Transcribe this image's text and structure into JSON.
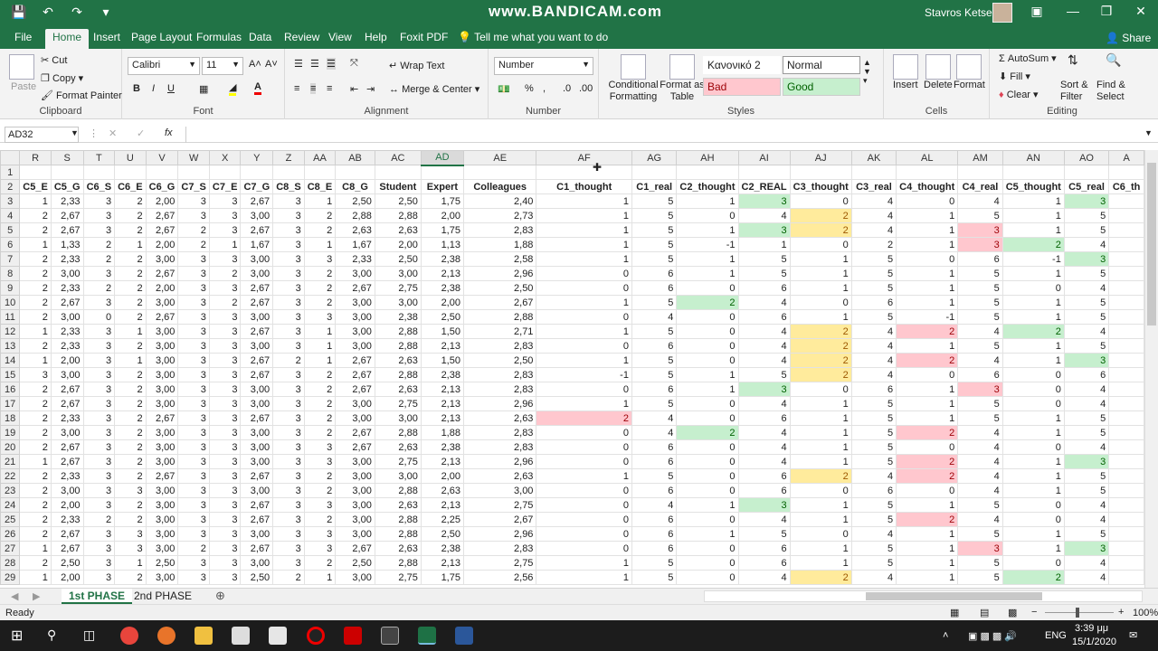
{
  "window": {
    "watermark": "www.BANDICAM.com",
    "user": "Stavros Ketseas"
  },
  "tabs": [
    "File",
    "Home",
    "Insert",
    "Page Layout",
    "Formulas",
    "Data",
    "Review",
    "View",
    "Help",
    "Foxit PDF"
  ],
  "tell_me": "Tell me what you want to do",
  "share": "Share",
  "clipboard": {
    "cut": "Cut",
    "copy": "Copy",
    "paste": "Paste",
    "format_painter": "Format Painter",
    "label": "Clipboard"
  },
  "font": {
    "name": "Calibri",
    "size": "11",
    "label": "Font"
  },
  "alignment": {
    "wrap": "Wrap Text",
    "merge": "Merge & Center",
    "label": "Alignment"
  },
  "number": {
    "format": "Number",
    "label": "Number"
  },
  "styles": {
    "cond": "Conditional Formatting",
    "table": "Format as Table",
    "normal_gr": "Κανονικό 2",
    "normal": "Normal",
    "bad": "Bad",
    "good": "Good",
    "label": "Styles"
  },
  "cells": {
    "insert": "Insert",
    "delete": "Delete",
    "format": "Format",
    "label": "Cells"
  },
  "editing": {
    "autosum": "AutoSum",
    "fill": "Fill",
    "clear": "Clear",
    "sort": "Sort & Filter",
    "find": "Find & Select",
    "label": "Editing"
  },
  "namebox": "AD32",
  "columns": [
    "R",
    "S",
    "T",
    "U",
    "V",
    "W",
    "X",
    "Y",
    "Z",
    "AA",
    "AB",
    "AC",
    "AD",
    "AE",
    "AF",
    "AG",
    "AH",
    "AI",
    "AJ",
    "AK",
    "AL",
    "AM",
    "AN",
    "AO",
    "A"
  ],
  "headers": [
    "C5_E",
    "C5_G",
    "C6_S",
    "C6_E",
    "C6_G",
    "C7_S",
    "C7_E",
    "C7_G",
    "C8_S",
    "C8_E",
    "C8_G",
    "Student",
    "Expert",
    "Colleagues",
    "C1_thought",
    "C1_real",
    "C2_thought",
    "C2_REAL",
    "C3_thought",
    "C3_real",
    "C4_thought",
    "C4_real",
    "C5_thought",
    "C5_real",
    "C6_th"
  ],
  "rows": [
    [
      "1",
      "2,33",
      "3",
      "2",
      "2,00",
      "3",
      "3",
      "2,67",
      "3",
      "1",
      "2,50",
      "2,50",
      "1,75",
      "2,40",
      "1",
      "5",
      "1",
      "3",
      "0",
      "4",
      "0",
      "4",
      "1",
      "3"
    ],
    [
      "2",
      "2,67",
      "3",
      "2",
      "2,67",
      "3",
      "3",
      "3,00",
      "3",
      "2",
      "2,88",
      "2,88",
      "2,00",
      "2,73",
      "1",
      "5",
      "0",
      "4",
      "2",
      "4",
      "1",
      "5",
      "1",
      "5"
    ],
    [
      "2",
      "2,67",
      "3",
      "2",
      "2,67",
      "2",
      "3",
      "2,67",
      "3",
      "2",
      "2,63",
      "2,63",
      "1,75",
      "2,83",
      "1",
      "5",
      "1",
      "3",
      "2",
      "4",
      "1",
      "3",
      "1",
      "5"
    ],
    [
      "1",
      "1,33",
      "2",
      "1",
      "2,00",
      "2",
      "1",
      "1,67",
      "3",
      "1",
      "1,67",
      "2,00",
      "1,13",
      "1,88",
      "1",
      "5",
      "-1",
      "1",
      "0",
      "2",
      "1",
      "3",
      "2",
      "4"
    ],
    [
      "2",
      "2,33",
      "2",
      "2",
      "3,00",
      "3",
      "3",
      "3,00",
      "3",
      "3",
      "2,33",
      "2,50",
      "2,38",
      "2,58",
      "1",
      "5",
      "1",
      "5",
      "1",
      "5",
      "0",
      "6",
      "-1",
      "3"
    ],
    [
      "2",
      "3,00",
      "3",
      "2",
      "2,67",
      "3",
      "2",
      "3,00",
      "3",
      "2",
      "3,00",
      "3,00",
      "2,13",
      "2,96",
      "0",
      "6",
      "1",
      "5",
      "1",
      "5",
      "1",
      "5",
      "1",
      "5"
    ],
    [
      "2",
      "2,33",
      "2",
      "2",
      "2,00",
      "3",
      "3",
      "2,67",
      "3",
      "2",
      "2,67",
      "2,75",
      "2,38",
      "2,50",
      "0",
      "6",
      "0",
      "6",
      "1",
      "5",
      "1",
      "5",
      "0",
      "4"
    ],
    [
      "2",
      "2,67",
      "3",
      "2",
      "3,00",
      "3",
      "2",
      "2,67",
      "3",
      "2",
      "3,00",
      "3,00",
      "2,00",
      "2,67",
      "1",
      "5",
      "2",
      "4",
      "0",
      "6",
      "1",
      "5",
      "1",
      "5"
    ],
    [
      "2",
      "3,00",
      "0",
      "2",
      "2,67",
      "3",
      "3",
      "3,00",
      "3",
      "3",
      "3,00",
      "2,38",
      "2,50",
      "2,88",
      "0",
      "4",
      "0",
      "6",
      "1",
      "5",
      "-1",
      "5",
      "1",
      "5"
    ],
    [
      "1",
      "2,33",
      "3",
      "1",
      "3,00",
      "3",
      "3",
      "2,67",
      "3",
      "1",
      "3,00",
      "2,88",
      "1,50",
      "2,71",
      "1",
      "5",
      "0",
      "4",
      "2",
      "4",
      "2",
      "4",
      "2",
      "4"
    ],
    [
      "2",
      "2,33",
      "3",
      "2",
      "3,00",
      "3",
      "3",
      "3,00",
      "3",
      "1",
      "3,00",
      "2,88",
      "2,13",
      "2,83",
      "0",
      "6",
      "0",
      "4",
      "2",
      "4",
      "1",
      "5",
      "1",
      "5"
    ],
    [
      "1",
      "2,00",
      "3",
      "1",
      "3,00",
      "3",
      "3",
      "2,67",
      "2",
      "1",
      "2,67",
      "2,63",
      "1,50",
      "2,50",
      "1",
      "5",
      "0",
      "4",
      "2",
      "4",
      "2",
      "4",
      "1",
      "3"
    ],
    [
      "3",
      "3,00",
      "3",
      "2",
      "3,00",
      "3",
      "3",
      "2,67",
      "3",
      "2",
      "2,67",
      "2,88",
      "2,38",
      "2,83",
      "-1",
      "5",
      "1",
      "5",
      "2",
      "4",
      "0",
      "6",
      "0",
      "6"
    ],
    [
      "2",
      "2,67",
      "3",
      "2",
      "3,00",
      "3",
      "3",
      "3,00",
      "3",
      "2",
      "2,67",
      "2,63",
      "2,13",
      "2,83",
      "0",
      "6",
      "1",
      "3",
      "0",
      "6",
      "1",
      "3",
      "0",
      "4"
    ],
    [
      "2",
      "2,67",
      "3",
      "2",
      "3,00",
      "3",
      "3",
      "3,00",
      "3",
      "2",
      "3,00",
      "2,75",
      "2,13",
      "2,96",
      "1",
      "5",
      "0",
      "4",
      "1",
      "5",
      "1",
      "5",
      "0",
      "4"
    ],
    [
      "2",
      "2,33",
      "3",
      "2",
      "2,67",
      "3",
      "3",
      "2,67",
      "3",
      "2",
      "3,00",
      "3,00",
      "2,13",
      "2,63",
      "2",
      "4",
      "0",
      "6",
      "1",
      "5",
      "1",
      "5",
      "1",
      "5"
    ],
    [
      "2",
      "3,00",
      "3",
      "2",
      "3,00",
      "3",
      "3",
      "3,00",
      "3",
      "2",
      "2,67",
      "2,88",
      "1,88",
      "2,83",
      "0",
      "4",
      "2",
      "4",
      "1",
      "5",
      "2",
      "4",
      "1",
      "5"
    ],
    [
      "2",
      "2,67",
      "3",
      "2",
      "3,00",
      "3",
      "3",
      "3,00",
      "3",
      "3",
      "2,67",
      "2,63",
      "2,38",
      "2,83",
      "0",
      "6",
      "0",
      "4",
      "1",
      "5",
      "0",
      "4",
      "0",
      "4"
    ],
    [
      "1",
      "2,67",
      "3",
      "2",
      "3,00",
      "3",
      "3",
      "3,00",
      "3",
      "3",
      "3,00",
      "2,75",
      "2,13",
      "2,96",
      "0",
      "6",
      "0",
      "4",
      "1",
      "5",
      "2",
      "4",
      "1",
      "3"
    ],
    [
      "2",
      "2,33",
      "3",
      "2",
      "2,67",
      "3",
      "3",
      "2,67",
      "3",
      "2",
      "3,00",
      "3,00",
      "2,00",
      "2,63",
      "1",
      "5",
      "0",
      "6",
      "2",
      "4",
      "2",
      "4",
      "1",
      "5"
    ],
    [
      "2",
      "3,00",
      "3",
      "3",
      "3,00",
      "3",
      "3",
      "3,00",
      "3",
      "2",
      "3,00",
      "2,88",
      "2,63",
      "3,00",
      "0",
      "6",
      "0",
      "6",
      "0",
      "6",
      "0",
      "4",
      "1",
      "5"
    ],
    [
      "2",
      "2,00",
      "3",
      "2",
      "3,00",
      "3",
      "3",
      "2,67",
      "3",
      "3",
      "3,00",
      "2,63",
      "2,13",
      "2,75",
      "0",
      "4",
      "1",
      "3",
      "1",
      "5",
      "1",
      "5",
      "0",
      "4"
    ],
    [
      "2",
      "2,33",
      "2",
      "2",
      "3,00",
      "3",
      "3",
      "2,67",
      "3",
      "2",
      "3,00",
      "2,88",
      "2,25",
      "2,67",
      "0",
      "6",
      "0",
      "4",
      "1",
      "5",
      "2",
      "4",
      "0",
      "4"
    ],
    [
      "2",
      "2,67",
      "3",
      "3",
      "3,00",
      "3",
      "3",
      "3,00",
      "3",
      "3",
      "3,00",
      "2,88",
      "2,50",
      "2,96",
      "0",
      "6",
      "1",
      "5",
      "0",
      "4",
      "1",
      "5",
      "1",
      "5"
    ],
    [
      "1",
      "2,67",
      "3",
      "3",
      "3,00",
      "2",
      "3",
      "2,67",
      "3",
      "3",
      "2,67",
      "2,63",
      "2,38",
      "2,83",
      "0",
      "6",
      "0",
      "6",
      "1",
      "5",
      "1",
      "3",
      "1",
      "3"
    ],
    [
      "2",
      "2,50",
      "3",
      "1",
      "2,50",
      "3",
      "3",
      "3,00",
      "3",
      "2",
      "2,50",
      "2,88",
      "2,13",
      "2,75",
      "1",
      "5",
      "0",
      "6",
      "1",
      "5",
      "1",
      "5",
      "0",
      "4"
    ],
    [
      "1",
      "2,00",
      "3",
      "2",
      "3,00",
      "3",
      "3",
      "2,50",
      "2",
      "1",
      "3,00",
      "2,75",
      "1,75",
      "2,56",
      "1",
      "5",
      "0",
      "4",
      "2",
      "4",
      "1",
      "5",
      "2",
      "4"
    ]
  ],
  "row_numbers": [
    "1",
    "2",
    "3",
    "4",
    "5",
    "6",
    "7",
    "8",
    "9",
    "10",
    "11",
    "12",
    "13",
    "14",
    "15",
    "16",
    "17",
    "18",
    "19",
    "20",
    "21",
    "22",
    "23",
    "24",
    "25",
    "26",
    "27",
    "28",
    "29"
  ],
  "sheets": [
    "1st PHASE",
    "2nd PHASE"
  ],
  "status": {
    "ready": "Ready",
    "zoom": "100%"
  },
  "clock": {
    "time": "3:39 μμ",
    "date": "15/1/2020",
    "lang": "ENG"
  }
}
